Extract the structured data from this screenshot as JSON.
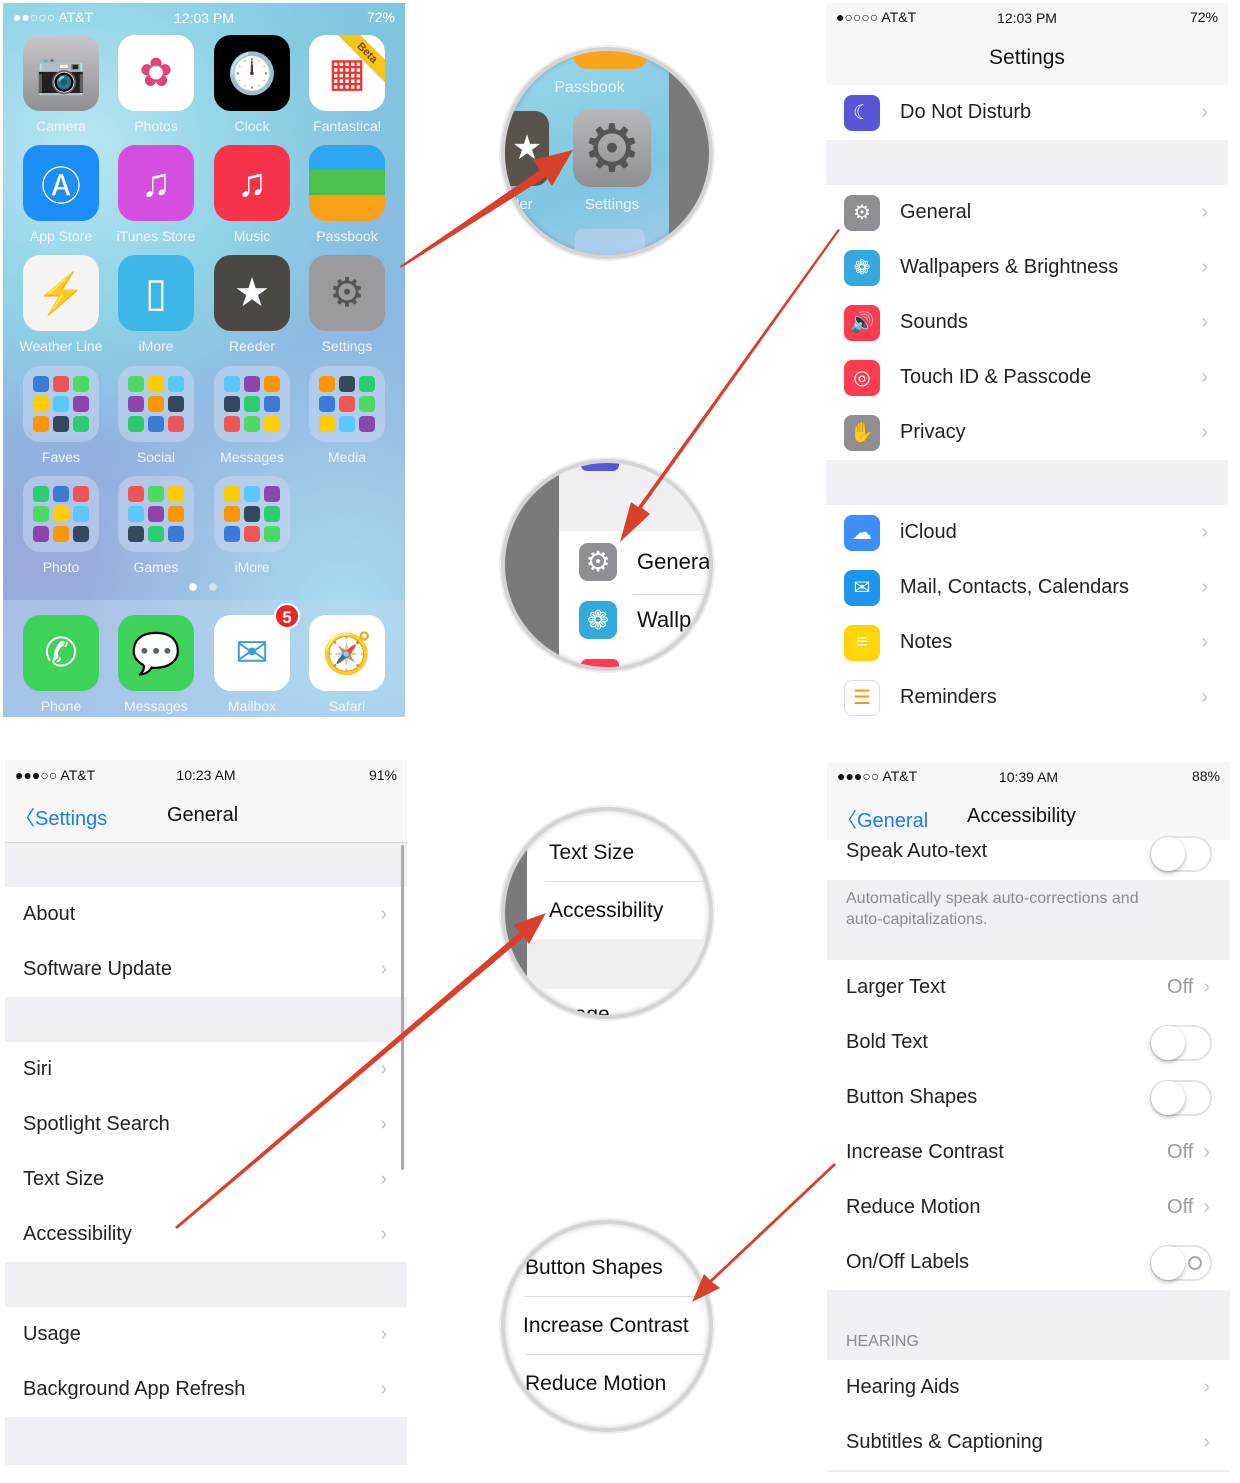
{
  "home": {
    "status": {
      "carrier": "●●○○○ AT&T",
      "time": "12:03 PM",
      "battery": "72%"
    },
    "apps": [
      {
        "label": "Camera",
        "icon": "camera-icon",
        "color": "#8e8e93"
      },
      {
        "label": "Photos",
        "icon": "photos-icon",
        "color": "#ffffff"
      },
      {
        "label": "Clock",
        "icon": "clock-icon",
        "color": "#000000"
      },
      {
        "label": "Fantastical",
        "icon": "calendar-icon",
        "color": "#ffffff",
        "ribbon": "Beta"
      },
      {
        "label": "App Store",
        "icon": "app-store-icon",
        "color": "#1d8ef5"
      },
      {
        "label": "iTunes Store",
        "icon": "itunes-icon",
        "color": "#d64ee0"
      },
      {
        "label": "Music",
        "icon": "music-icon",
        "color": "#f5344a"
      },
      {
        "label": "Passbook",
        "icon": "passbook-icon",
        "color": "#34a853"
      },
      {
        "label": "Weather Line",
        "icon": "weather-icon",
        "color": "#f4f4f4"
      },
      {
        "label": "iMore",
        "icon": "phone-device-icon",
        "color": "#3fb6e8"
      },
      {
        "label": "Reeder",
        "icon": "star-icon",
        "color": "#4b4844"
      },
      {
        "label": "Settings",
        "icon": "gear-icon",
        "color": "#9a9a9f"
      }
    ],
    "folders": [
      {
        "label": "Faves"
      },
      {
        "label": "Social"
      },
      {
        "label": "Messages"
      },
      {
        "label": "Media"
      },
      {
        "label": "Photo"
      },
      {
        "label": "Games"
      },
      {
        "label": "iMore"
      }
    ],
    "dock": [
      {
        "label": "Phone",
        "icon": "phone-icon",
        "color": "#3fd25a"
      },
      {
        "label": "Messages",
        "icon": "message-bubble-icon",
        "color": "#3fd25a"
      },
      {
        "label": "Mailbox",
        "icon": "mailbox-icon",
        "color": "#ffffff",
        "badge": "5"
      },
      {
        "label": "Safari",
        "icon": "compass-icon",
        "color": "#ffffff"
      }
    ]
  },
  "settings": {
    "status": {
      "carrier": "●○○○○ AT&T",
      "time": "12:03 PM",
      "battery": "72%"
    },
    "title": "Settings",
    "groups": [
      [
        {
          "label": "Do Not Disturb",
          "icon": "moon-icon",
          "color": "#5856d6",
          "glyph": "☾"
        }
      ],
      [
        {
          "label": "General",
          "icon": "gear-icon",
          "color": "#8e8e93",
          "glyph": "⚙"
        },
        {
          "label": "Wallpapers & Brightness",
          "icon": "flower-icon",
          "color": "#34aadc",
          "glyph": "❁"
        },
        {
          "label": "Sounds",
          "icon": "speaker-icon",
          "color": "#ff3b50",
          "glyph": "🔊"
        },
        {
          "label": "Touch ID & Passcode",
          "icon": "fingerprint-icon",
          "color": "#ff3b50",
          "glyph": "◎"
        },
        {
          "label": "Privacy",
          "icon": "hand-icon",
          "color": "#8e8e93",
          "glyph": "✋"
        }
      ],
      [
        {
          "label": "iCloud",
          "icon": "cloud-icon",
          "color": "#3e8ef7",
          "glyph": "☁"
        },
        {
          "label": "Mail, Contacts, Calendars",
          "icon": "envelope-icon",
          "color": "#1e96f0",
          "glyph": "✉"
        },
        {
          "label": "Notes",
          "icon": "notes-icon",
          "color": "#ffd60a",
          "glyph": "≡"
        },
        {
          "label": "Reminders",
          "icon": "list-icon",
          "color": "#ffffff",
          "glyph": "☰"
        }
      ]
    ]
  },
  "general": {
    "status": {
      "carrier": "●●●○○ AT&T",
      "time": "10:23 AM",
      "battery": "91%"
    },
    "back": "Settings",
    "title": "General",
    "groups": [
      [
        "About",
        "Software Update"
      ],
      [
        "Siri",
        "Spotlight Search",
        "Text Size",
        "Accessibility"
      ],
      [
        "Usage",
        "Background App Refresh"
      ]
    ]
  },
  "accessibility": {
    "status": {
      "carrier": "●●●○○ AT&T",
      "time": "10:39 AM",
      "battery": "88%"
    },
    "back": "General",
    "title": "Accessibility",
    "speak_auto_text": "Speak Auto-text",
    "footer": "Automatically speak auto-corrections and auto-capitalizations.",
    "rows": [
      {
        "label": "Larger Text",
        "value": "Off",
        "type": "link"
      },
      {
        "label": "Bold Text",
        "type": "toggle",
        "on": false
      },
      {
        "label": "Button Shapes",
        "type": "toggle",
        "on": false
      },
      {
        "label": "Increase Contrast",
        "value": "Off",
        "type": "link"
      },
      {
        "label": "Reduce Motion",
        "value": "Off",
        "type": "link"
      },
      {
        "label": "On/Off Labels",
        "type": "toggle",
        "on": false
      }
    ],
    "hearing_header": "HEARING",
    "hearing": [
      "Hearing Aids",
      "Subtitles & Captioning"
    ]
  },
  "callouts": {
    "c1": {
      "top": "Passbook",
      "main": "Settings",
      "left": "der"
    },
    "c2": {
      "rows": [
        "Genera",
        "Wallp"
      ]
    },
    "c3": {
      "rows": [
        "Text Size",
        "Accessibility",
        "Usage"
      ]
    },
    "c4": {
      "rows": [
        "Button Shapes",
        "Increase Contrast",
        "Reduce Motion"
      ]
    }
  },
  "colors": {
    "arrow": "#d8402b",
    "ios_blue": "#1a7cf5",
    "group_bg": "#efeff4"
  }
}
